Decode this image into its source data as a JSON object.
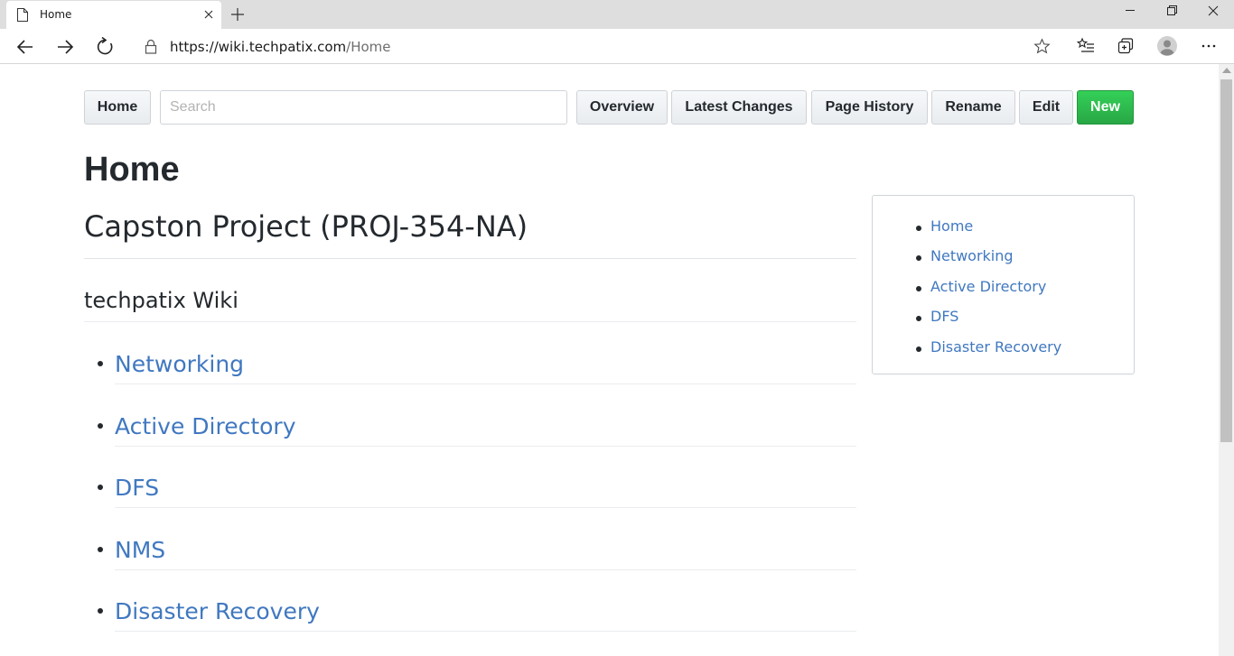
{
  "browser": {
    "tab_title": "Home",
    "url_host": "https://wiki.techpatix.com",
    "url_path": "/Home"
  },
  "wiki_nav": {
    "home_label": "Home",
    "search_placeholder": "Search",
    "overview_label": "Overview",
    "latest_changes_label": "Latest Changes",
    "page_history_label": "Page History",
    "rename_label": "Rename",
    "edit_label": "Edit",
    "new_label": "New"
  },
  "page": {
    "title": "Home",
    "heading": "Capston Project (PROJ-354-NA)",
    "subheading": "techpatix Wiki",
    "links": [
      "Networking",
      "Active Directory",
      "DFS",
      "NMS",
      "Disaster Recovery"
    ]
  },
  "toc": {
    "items": [
      "Home",
      "Networking",
      "Active Directory",
      "DFS",
      "Disaster Recovery"
    ]
  },
  "colors": {
    "link": "#4078c0",
    "new_button": "#28a745",
    "text": "#24292e"
  }
}
